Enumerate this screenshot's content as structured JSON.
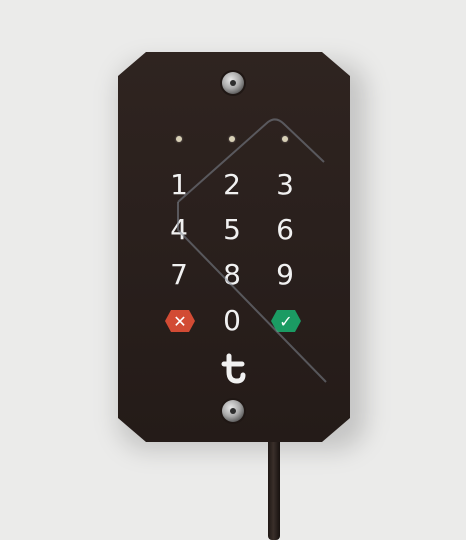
{
  "keypad": {
    "keys": [
      "1",
      "2",
      "3",
      "4",
      "5",
      "6",
      "7",
      "8",
      "9",
      "0"
    ],
    "cancel_symbol": "✕",
    "confirm_symbol": "✓",
    "logo_icon": "lock-handle-logo"
  },
  "colors": {
    "background": "#ebebea",
    "device_body": "#2a201d",
    "cancel": "#d24b34",
    "confirm": "#1b9b63",
    "digits": "#f1f1f1"
  }
}
